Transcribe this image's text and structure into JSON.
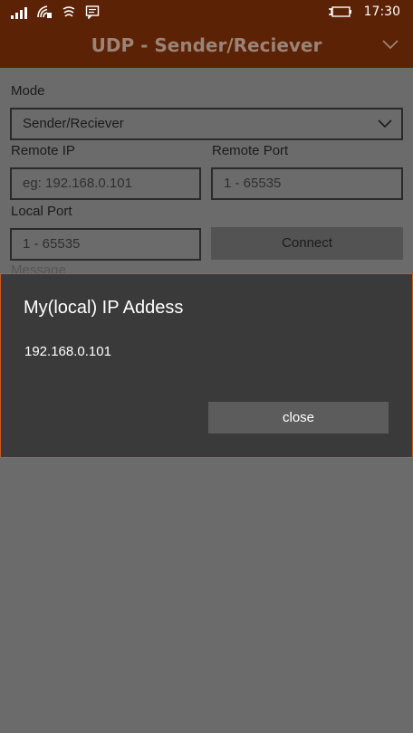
{
  "status_bar": {
    "time": "17:30",
    "icons": [
      "signal-bars-icon",
      "wifi-phone-icon",
      "wifi-icon",
      "message-icon",
      "battery-charging-icon"
    ]
  },
  "header": {
    "title": "UDP - Sender/Reciever",
    "menu_icon": "chevron-down-icon"
  },
  "form": {
    "mode_label": "Mode",
    "mode_value": "Sender/Reciever",
    "remote_ip_label": "Remote IP",
    "remote_ip_placeholder": "eg: 192.168.0.101",
    "remote_port_label": "Remote Port",
    "remote_port_placeholder": "1 - 65535",
    "local_port_label": "Local Port",
    "local_port_placeholder": "1 - 65535",
    "connect_label": "Connect",
    "message_label": "Message"
  },
  "dialog": {
    "title": "My(local) IP Addess",
    "body": "192.168.0.101",
    "close_label": "close"
  },
  "colors": {
    "header_bg": "#5b2206",
    "dialog_border": "#c85a1e",
    "dialog_bg": "#3a3a3a",
    "page_bg": "#6b6b6b"
  }
}
